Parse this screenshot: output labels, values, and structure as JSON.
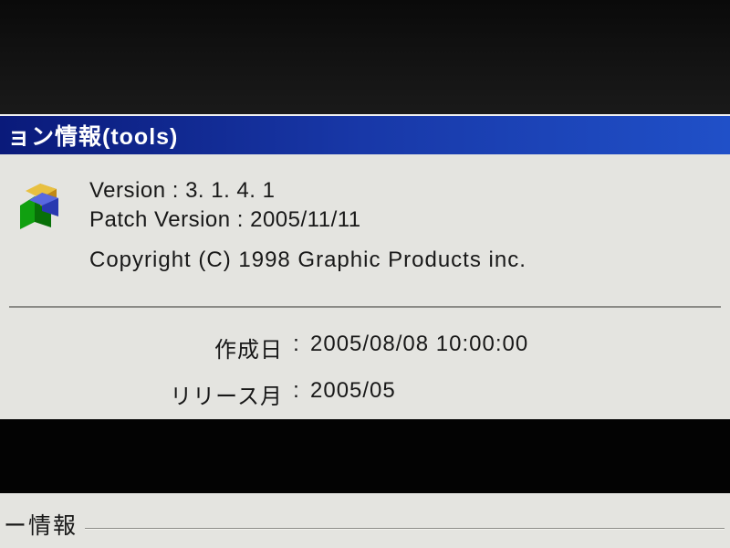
{
  "titlebar": {
    "title": "ョン情報(tools)"
  },
  "version_info": {
    "version_label": "Version : ",
    "version_value": "3. 1. 4. 1",
    "patch_label": "Patch Version : ",
    "patch_value": "2005/11/11",
    "copyright": "Copyright (C) 1998 Graphic Products inc."
  },
  "details": {
    "created_label": "作成日",
    "created_value": "2005/08/08 10:00:00",
    "release_label": "リリース月",
    "release_value": "2005/05"
  },
  "lower_section": {
    "legend": "ー情報"
  },
  "icon": {
    "name": "app-icon"
  }
}
